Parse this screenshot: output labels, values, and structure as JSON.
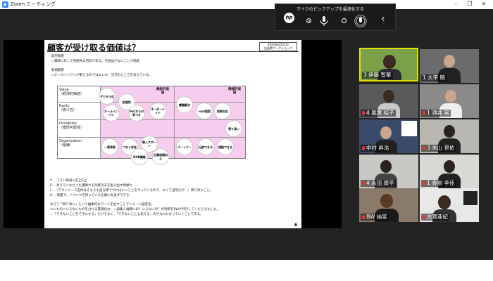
{
  "window": {
    "title": "Zoom ミーティング"
  },
  "video_bar": {
    "label": "マイクのピックアップを最適化する",
    "logo": "hp"
  },
  "slide": {
    "title": "顧客が受け取る価値は？",
    "date": "2021年3月11日",
    "org": "広島県ワークショップ",
    "sec1_head": "既存顧客",
    "sec1_text": "∟課題に対して持続的な回答がある。代替品がないことが価値",
    "sec2_head": "新規顧客",
    "sec2_text": "∟オールインワンが刺さるのではないか。欠点のところを伝えている。",
    "rows": [
      {
        "label": "Value",
        "sub": "（経済的価値）"
      },
      {
        "label": "Rarity",
        "sub": "（希少性）"
      },
      {
        "label": "Imitability",
        "sub": "（模倣可能性）"
      },
      {
        "label": "Organization",
        "sub": "（組織）"
      }
    ],
    "col_heads": [
      "機能的価値",
      "情緒的価値"
    ],
    "bubbles": [
      "デジタル化",
      "拡張性",
      "オールインワン",
      "VoCからの気づき",
      "オーダーメイド",
      "課題解決",
      "+αの提案",
      "柔軟対応",
      "寄り添い",
      "一貫体制",
      "つなぐ存在",
      "導入サポート",
      "HUB機能",
      "企業価値向上",
      "パートナー",
      "伝統できる",
      "相談できる"
    ],
    "notes": [
      "V …コスト削減+売上向上",
      "R …見えていなかった課題やその解決法を生み出す発想力",
      "I …（アウトソース自体はそもそも自分達でやればいいことをやっているので、なくて当然だが…）寄り添うこと。",
      "O …両面で、ノウハウを持っている企業に丸投げできる",
      "あえて「寄り添い」という抽象的なワードを出すことでイメージ固定化。",
      "いいものへいらないものを分ける最適化力…一般集人員頼いの？いらないの？の判断をBWが代行してくださるもした。",
      "…「できないことをできにする」だけでなく、「できないことも伝える」のが力にわかっていくことである。"
    ],
    "page": "6"
  },
  "participants": [
    {
      "name": "伊藤 智華",
      "num": "3",
      "muted": false
    },
    {
      "name": "大平 暁",
      "num": "1",
      "muted": false
    },
    {
      "name": "風薫 結子",
      "num": "4",
      "muted": true
    },
    {
      "name": "酒井 実",
      "num": "1",
      "muted": true
    },
    {
      "name": "中村 昇浩",
      "num": "",
      "muted": true
    },
    {
      "name": "木山 景佑",
      "num": "3",
      "muted": true
    },
    {
      "name": "永田 周平",
      "num": "4",
      "muted": true
    },
    {
      "name": "青柳 李佳",
      "num": "1",
      "muted": true
    },
    {
      "name": "BW 納富",
      "num": "",
      "muted": true
    },
    {
      "name": "古賀亜紀",
      "num": "",
      "muted": true
    }
  ],
  "colors": {
    "speaker_border": "#e0e000",
    "accent": "#2d8cff",
    "slide_pink": "#f6cdee"
  }
}
